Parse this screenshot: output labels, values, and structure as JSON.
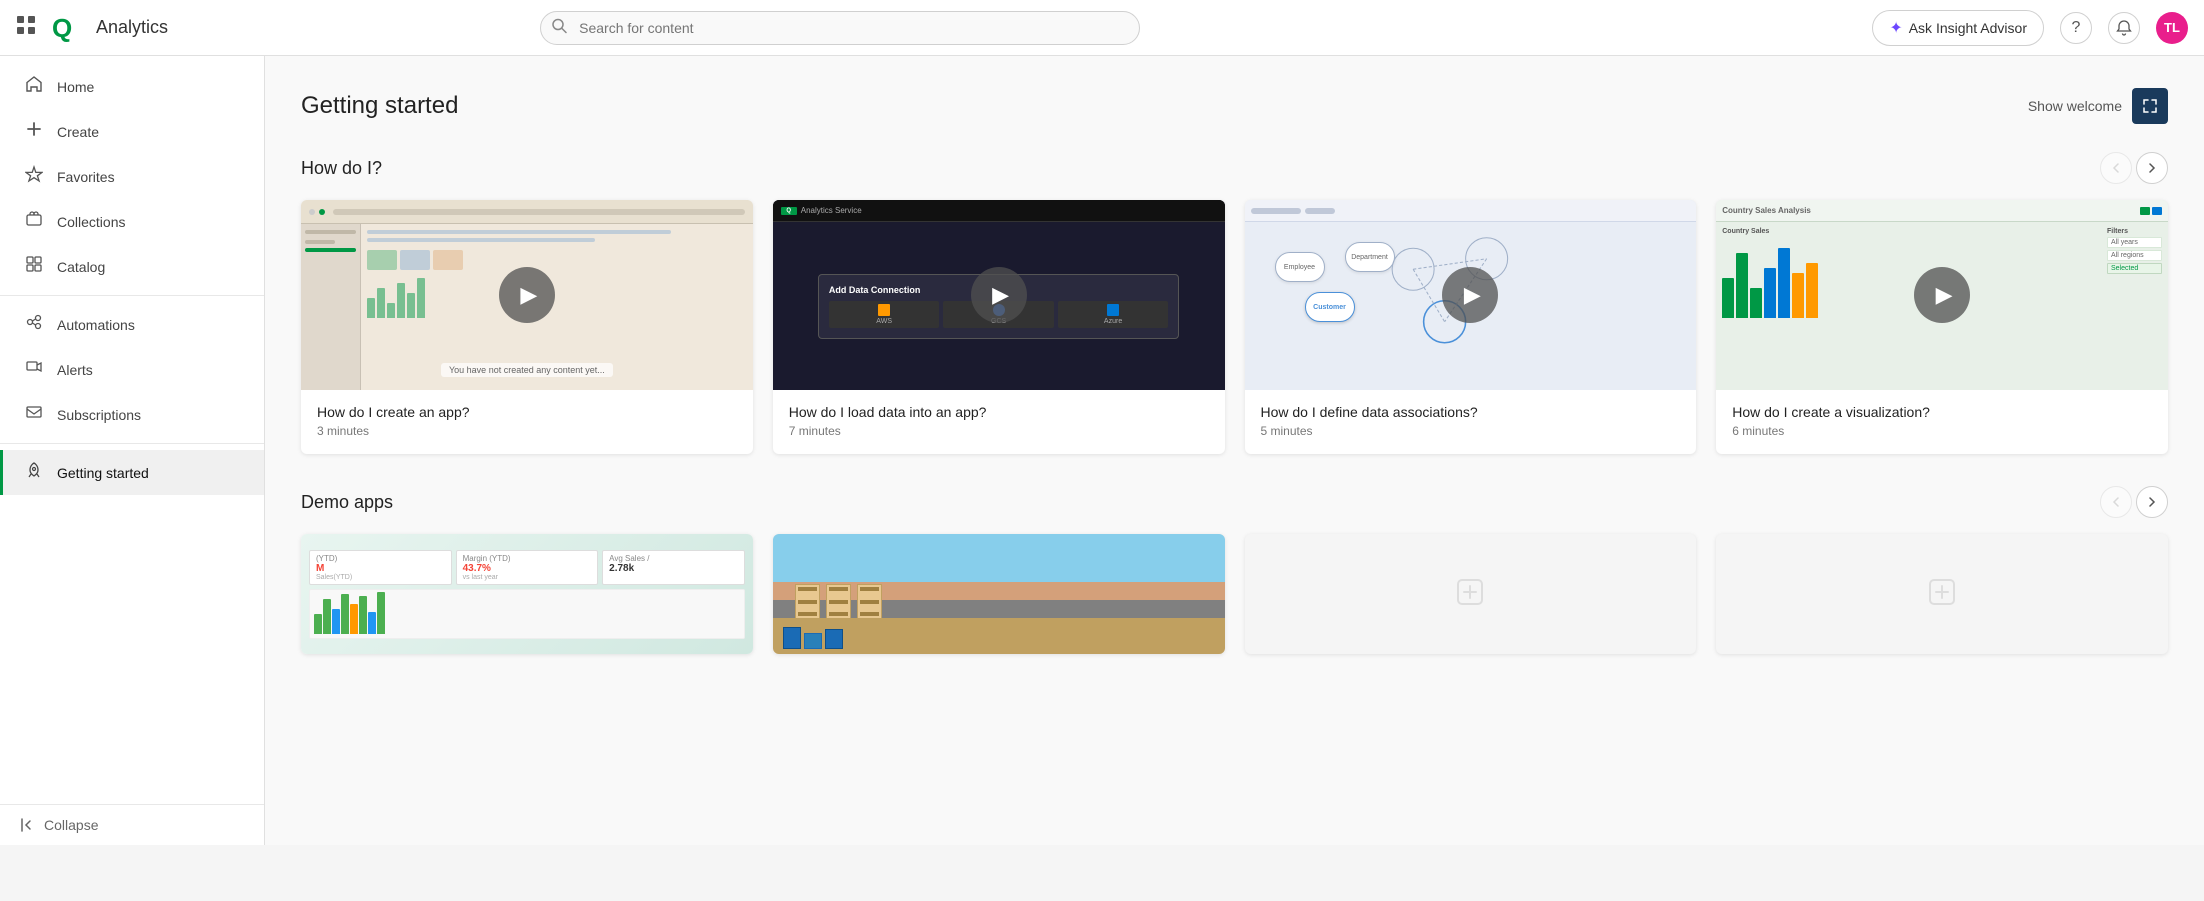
{
  "app": {
    "name": "Analytics"
  },
  "topbar": {
    "search_placeholder": "Search for content",
    "insight_btn_label": "Ask Insight Advisor",
    "help_icon": "?",
    "notifications_icon": "🔔",
    "avatar_initials": "TL"
  },
  "sidebar": {
    "items": [
      {
        "id": "home",
        "label": "Home",
        "icon": "home"
      },
      {
        "id": "create",
        "label": "Create",
        "icon": "plus"
      },
      {
        "id": "favorites",
        "label": "Favorites",
        "icon": "star"
      },
      {
        "id": "collections",
        "label": "Collections",
        "icon": "collections"
      },
      {
        "id": "catalog",
        "label": "Catalog",
        "icon": "catalog"
      },
      {
        "id": "automations",
        "label": "Automations",
        "icon": "automations"
      },
      {
        "id": "alerts",
        "label": "Alerts",
        "icon": "alerts"
      },
      {
        "id": "subscriptions",
        "label": "Subscriptions",
        "icon": "subscriptions"
      },
      {
        "id": "getting-started",
        "label": "Getting started",
        "icon": "rocket",
        "active": true
      }
    ],
    "collapse_label": "Collapse"
  },
  "page": {
    "title": "Getting started",
    "show_welcome_label": "Show welcome"
  },
  "how_do_i": {
    "section_title": "How do I?",
    "videos": [
      {
        "id": "create-app",
        "title": "How do I create an app?",
        "duration": "3 minutes"
      },
      {
        "id": "load-data",
        "title": "How do I load data into an app?",
        "duration": "7 minutes"
      },
      {
        "id": "data-associations",
        "title": "How do I define data associations?",
        "duration": "5 minutes"
      },
      {
        "id": "create-viz",
        "title": "How do I create a visualization?",
        "duration": "6 minutes"
      }
    ]
  },
  "demo_apps": {
    "section_title": "Demo apps"
  },
  "colors": {
    "active_nav": "#009845",
    "brand_green": "#009845",
    "purple_accent": "#6c47ff",
    "dark_blue": "#1a3a5c"
  }
}
